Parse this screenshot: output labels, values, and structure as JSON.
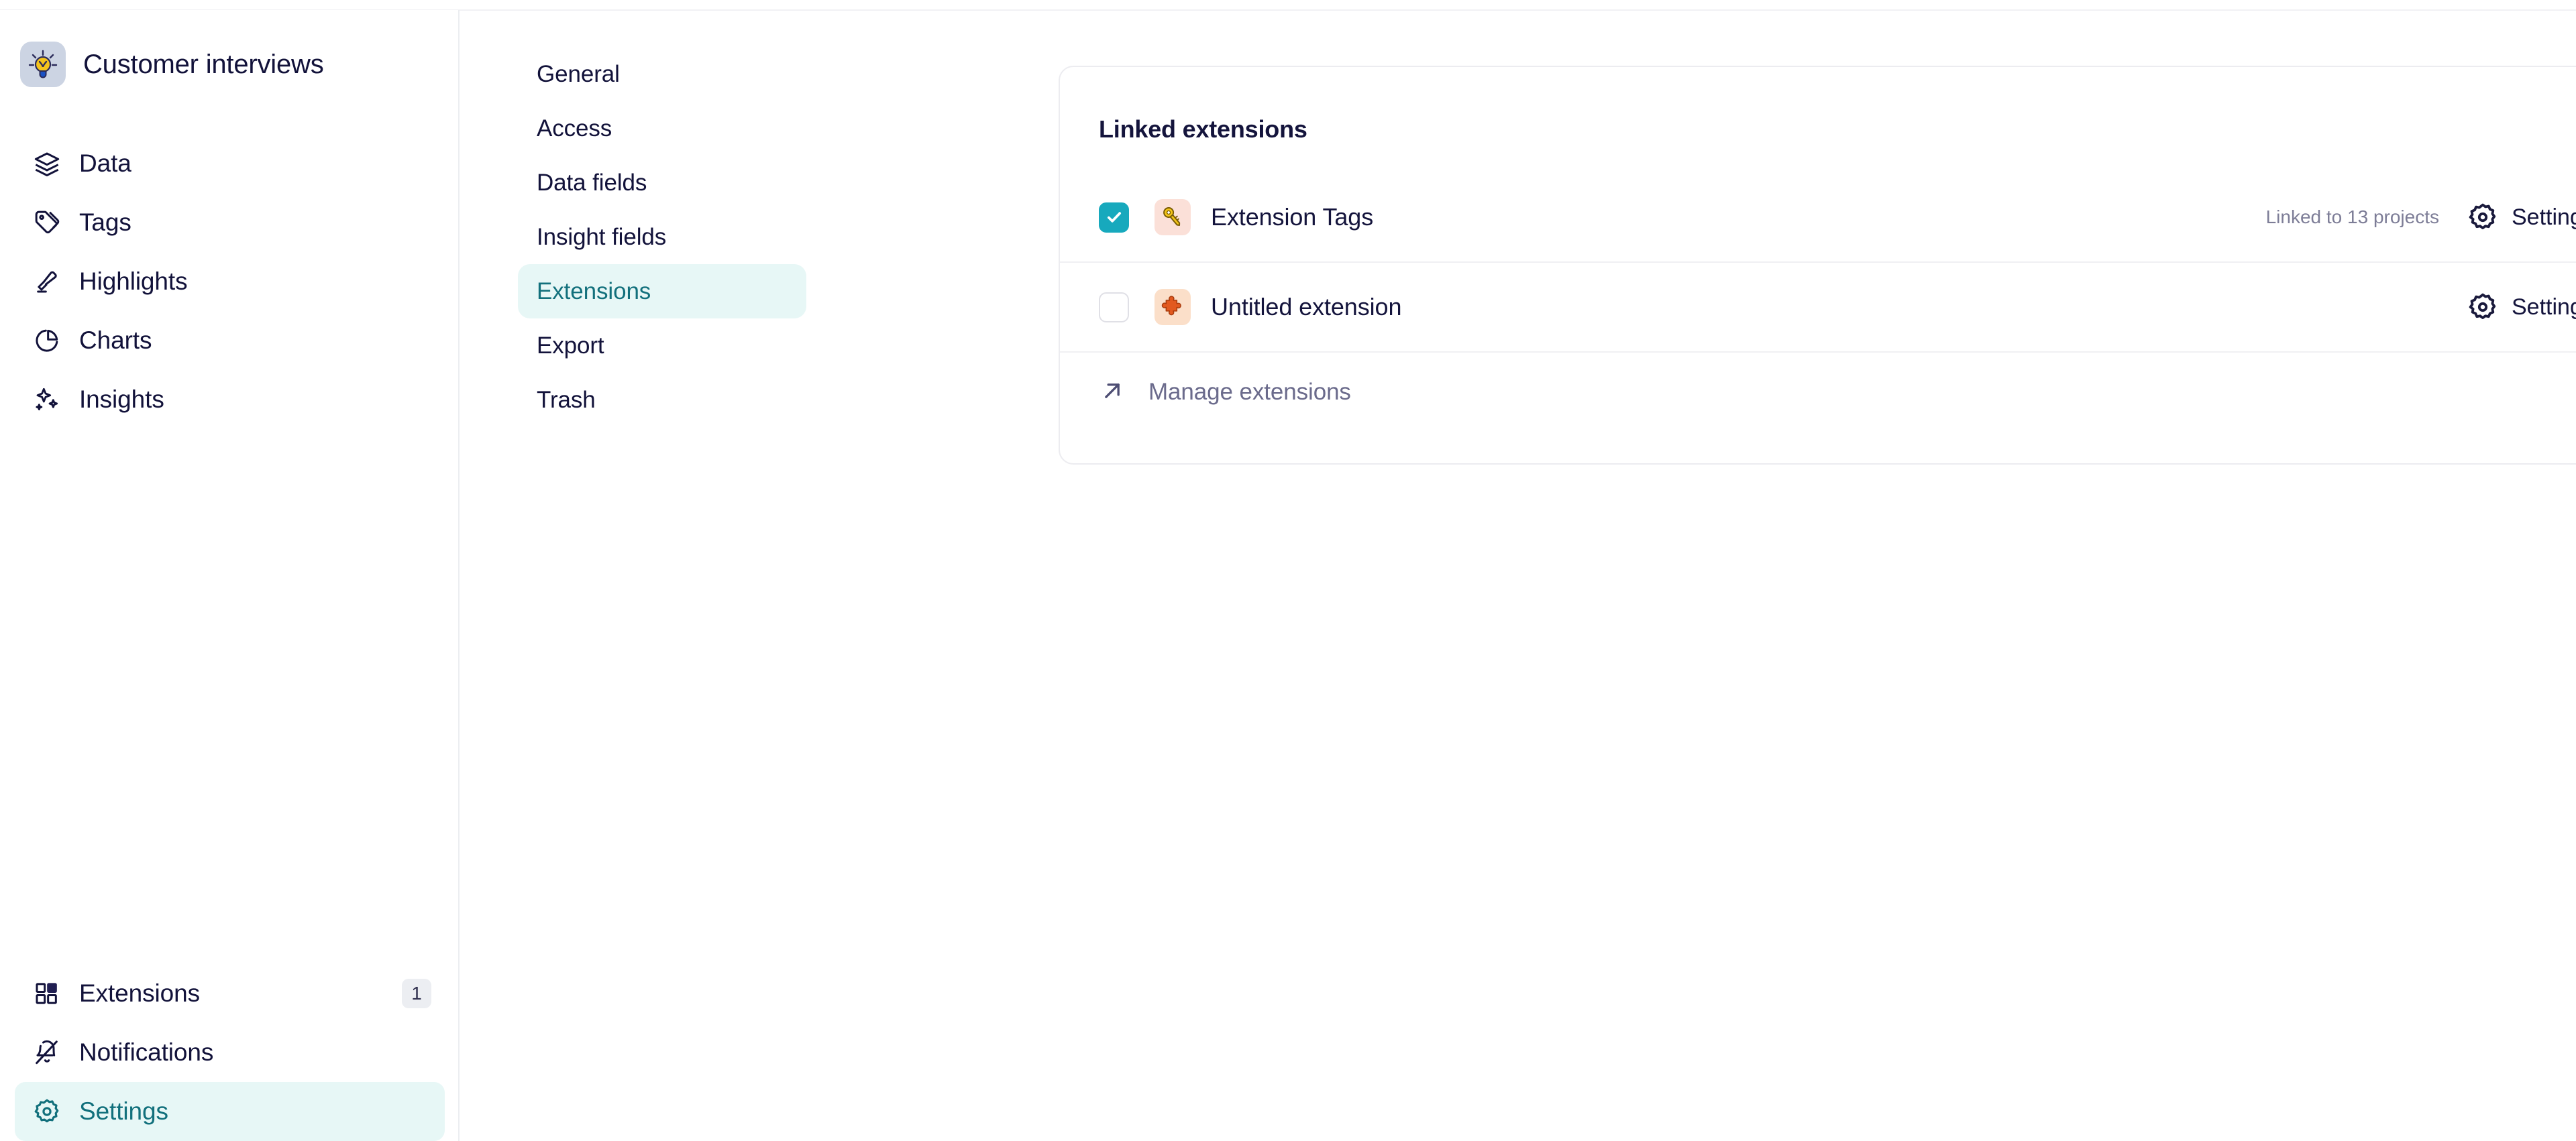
{
  "workspace": {
    "title": "Customer interviews",
    "logo_icon": "lightbulb-icon"
  },
  "sidebar": {
    "top_items": [
      {
        "label": "Data",
        "icon": "layers-icon"
      },
      {
        "label": "Tags",
        "icon": "tag-icon"
      },
      {
        "label": "Highlights",
        "icon": "highlighter-icon"
      },
      {
        "label": "Charts",
        "icon": "pie-chart-icon"
      },
      {
        "label": "Insights",
        "icon": "sparkles-icon"
      }
    ],
    "bottom_items": [
      {
        "label": "Extensions",
        "icon": "extensions-icon",
        "badge": "1",
        "active": false
      },
      {
        "label": "Notifications",
        "icon": "bell-off-icon",
        "badge": "",
        "active": false
      },
      {
        "label": "Settings",
        "icon": "gear-icon",
        "badge": "",
        "active": true
      }
    ]
  },
  "settings_menu": {
    "items": [
      {
        "label": "General",
        "active": false
      },
      {
        "label": "Access",
        "active": false
      },
      {
        "label": "Data fields",
        "active": false
      },
      {
        "label": "Insight fields",
        "active": false
      },
      {
        "label": "Extensions",
        "active": true
      },
      {
        "label": "Export",
        "active": false
      },
      {
        "label": "Trash",
        "active": false
      }
    ]
  },
  "card": {
    "title": "Linked extensions",
    "rows": [
      {
        "name": "Extension Tags",
        "icon": "key-icon",
        "checked": true,
        "meta": "Linked to 13 projects",
        "settings_label": "Settings"
      },
      {
        "name": "Untitled extension",
        "icon": "puzzle-piece-icon",
        "checked": false,
        "meta": "",
        "settings_label": "Settings"
      }
    ],
    "manage_link": {
      "label": "Manage extensions",
      "icon": "arrow-up-right-icon"
    }
  },
  "colors": {
    "accent_teal": "#12707c",
    "accent_teal_bg": "#e7f7f6",
    "checkbox_checked": "#17a9bd",
    "text_primary": "#14143c",
    "text_muted": "#7d7d97",
    "link_muted": "#6b6b8c",
    "border": "#ececf0",
    "logo_bg": "#ccd4e3"
  }
}
